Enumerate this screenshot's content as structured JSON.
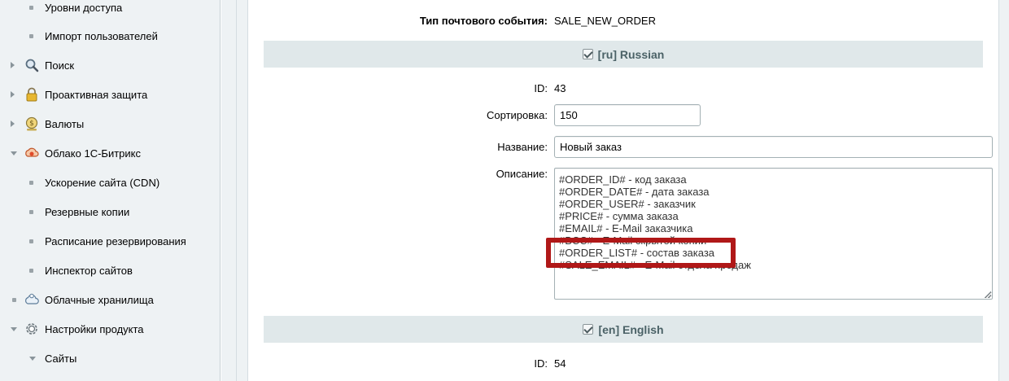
{
  "sidebar": {
    "items": [
      {
        "label": "Уровни доступа",
        "type": "sub"
      },
      {
        "label": "Импорт пользователей",
        "type": "sub"
      },
      {
        "label": "Поиск",
        "type": "top",
        "icon": "search-icon"
      },
      {
        "label": "Проактивная защита",
        "type": "top",
        "icon": "lock-icon"
      },
      {
        "label": "Валюты",
        "type": "top",
        "icon": "coin-icon"
      },
      {
        "label": "Облако 1С-Битрикс",
        "type": "top-open",
        "icon": "cloud-bitrix-icon"
      },
      {
        "label": "Ускорение сайта (CDN)",
        "type": "sub"
      },
      {
        "label": "Резервные копии",
        "type": "sub"
      },
      {
        "label": "Расписание резервирования",
        "type": "sub"
      },
      {
        "label": "Инспектор сайтов",
        "type": "sub"
      },
      {
        "label": "Облачные хранилища",
        "type": "top-bullet",
        "icon": "cloud-storage-icon"
      },
      {
        "label": "Настройки продукта",
        "type": "top-open",
        "icon": "gear-icon"
      },
      {
        "label": "Сайты",
        "type": "sub-open"
      }
    ]
  },
  "form": {
    "event_type_label": "Тип почтового события:",
    "event_type_value": "SALE_NEW_ORDER",
    "sections": [
      {
        "header": "[ru] Russian",
        "id_label": "ID:",
        "id_value": "43",
        "sort_label": "Сортировка:",
        "sort_value": "150",
        "name_label": "Название:",
        "name_value": "Новый заказ",
        "desc_label": "Описание:",
        "desc_lines": [
          "#ORDER_ID# - код заказа",
          "#ORDER_DATE# - дата заказа",
          "#ORDER_USER# - заказчик",
          "#PRICE# - сумма заказа",
          "#EMAIL# - E-Mail заказчика",
          "#BCC# - E-Mail скрытой копии",
          "#ORDER_LIST# - состав заказа",
          "#SALE_EMAIL# - E-Mail отдела продаж"
        ]
      },
      {
        "header": "[en] English",
        "id_label": "ID:",
        "id_value": "54"
      }
    ]
  },
  "colors": {
    "sidebar_bg": "#eef2f4",
    "section_header_bg": "#e0e8ea",
    "highlight": "#b01818"
  }
}
